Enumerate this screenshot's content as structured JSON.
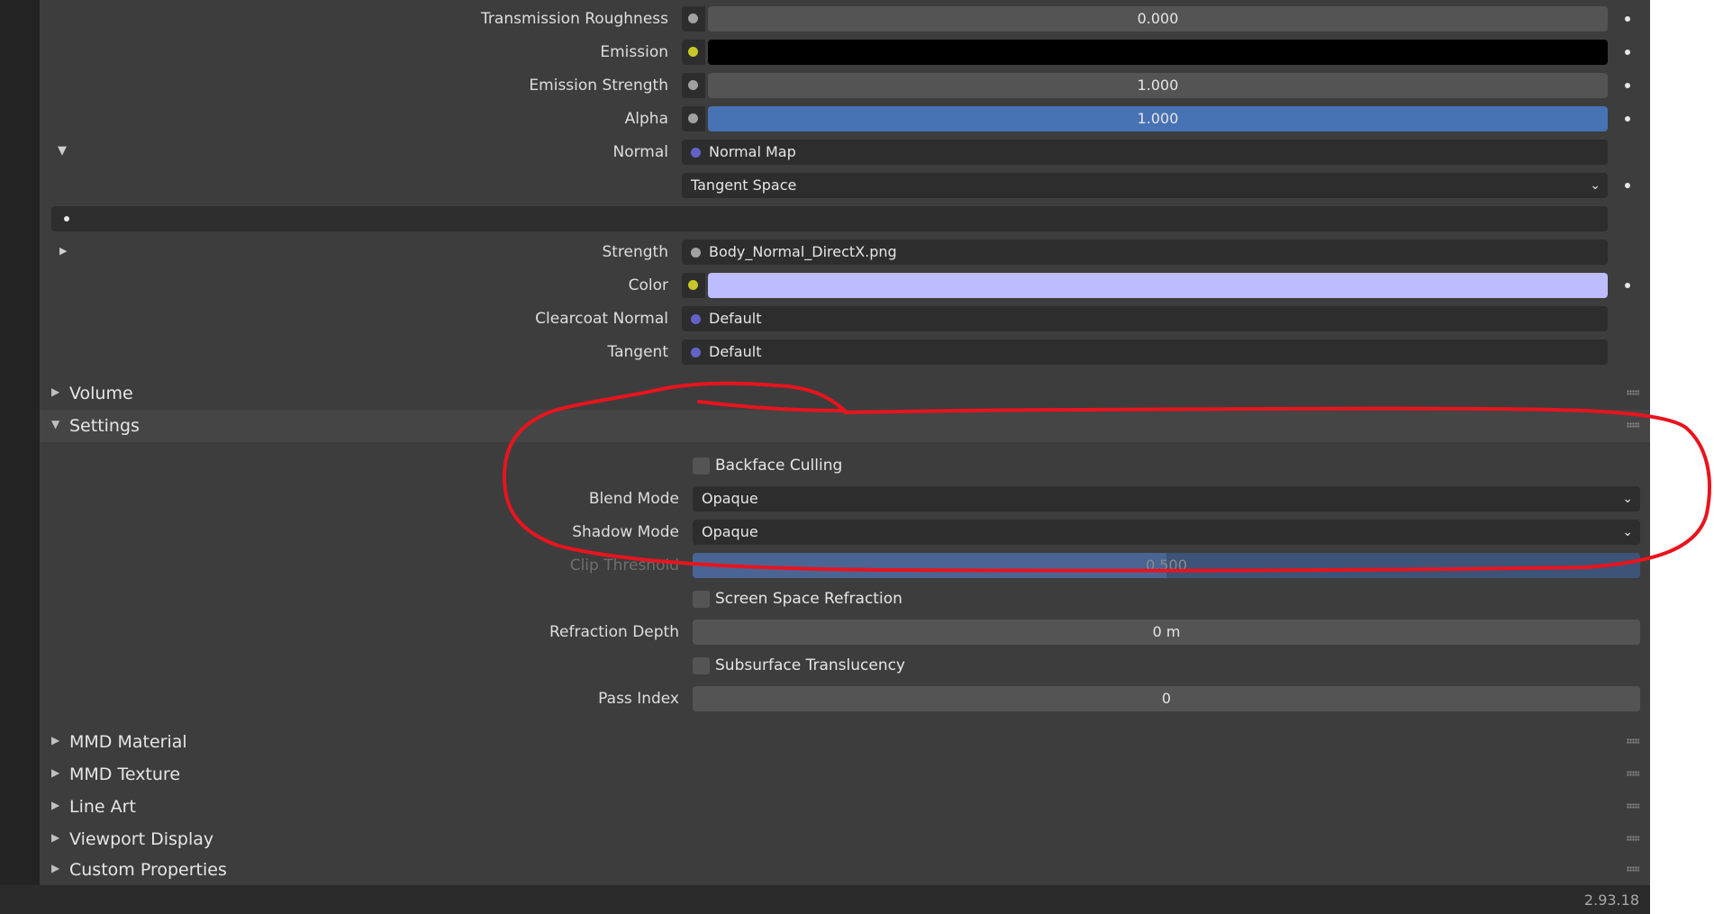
{
  "surface": {
    "fields": [
      {
        "label": "Transmission Roughness",
        "value": "0.000"
      },
      {
        "label": "Emission",
        "value": ""
      },
      {
        "label": "Emission Strength",
        "value": "1.000"
      },
      {
        "label": "Alpha",
        "value": "1.000"
      },
      {
        "label": "Normal",
        "value": "Normal Map"
      },
      {
        "label": "",
        "value": "Tangent Space"
      },
      {
        "label": "Strength",
        "value": "Body_Normal_DirectX.png"
      },
      {
        "label": "Color",
        "value": ""
      },
      {
        "label": "Clearcoat Normal",
        "value": "Default"
      },
      {
        "label": "Tangent",
        "value": "Default"
      }
    ]
  },
  "panels": {
    "volume": "Volume",
    "settings": "Settings",
    "mmd_material": "MMD Material",
    "mmd_texture": "MMD Texture",
    "line_art": "Line Art",
    "viewport_display": "Viewport Display",
    "custom_properties": "Custom Properties"
  },
  "settings": {
    "backface_culling": {
      "label": "Backface Culling",
      "checked": false
    },
    "blend_mode": {
      "label": "Blend Mode",
      "value": "Opaque"
    },
    "shadow_mode": {
      "label": "Shadow Mode",
      "value": "Opaque"
    },
    "clip_threshold": {
      "label": "Clip Threshold",
      "value": "0.500",
      "fraction": 0.5
    },
    "screen_space_refraction": {
      "label": "Screen Space Refraction",
      "checked": false
    },
    "refraction_depth": {
      "label": "Refraction Depth",
      "value": "0 m"
    },
    "subsurface_translucency": {
      "label": "Subsurface Translucency",
      "checked": false
    },
    "pass_index": {
      "label": "Pass Index",
      "value": "0"
    }
  },
  "status": {
    "version": "2.93.18"
  },
  "colors": {
    "emission": "#000000",
    "color": "#bcbcff",
    "alpha_bar": "#4772b3",
    "annotation": "#e8141e"
  },
  "icons": {
    "socket_float": "grey-socket-icon",
    "socket_color": "yellow-socket-icon",
    "socket_vector": "purple-socket-icon"
  }
}
